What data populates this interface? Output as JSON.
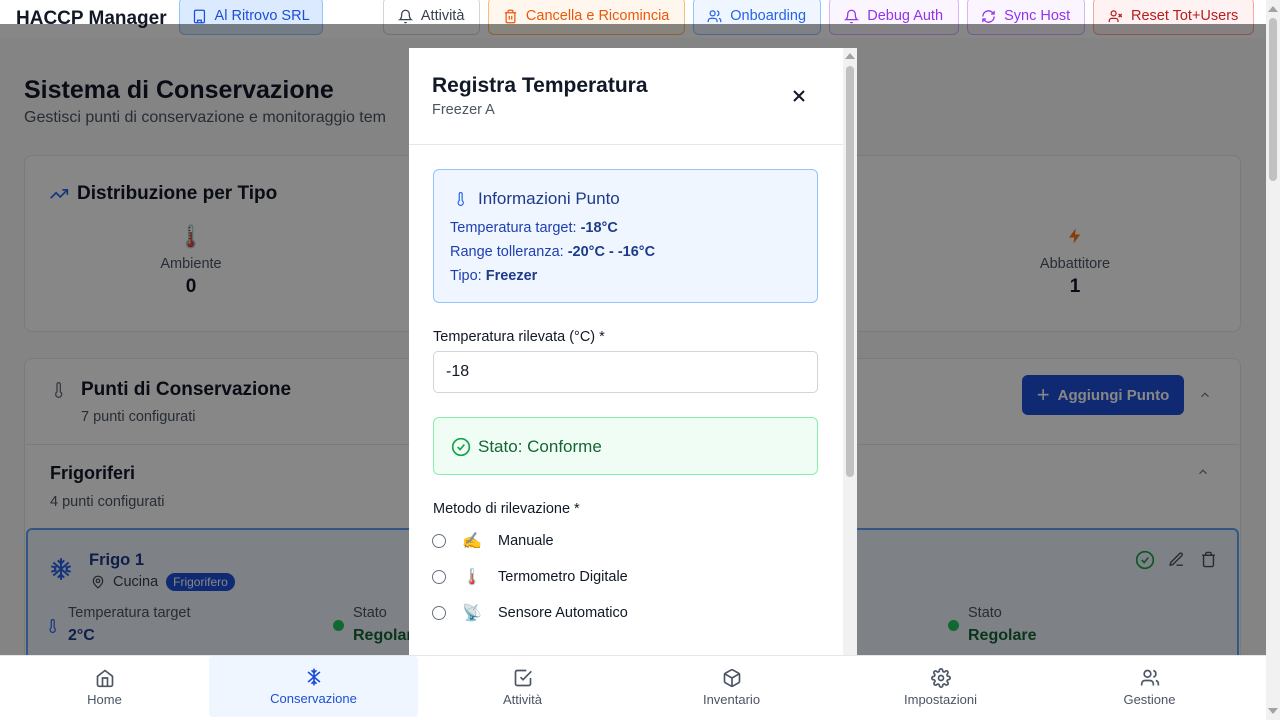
{
  "header": {
    "app_title": "HACCP Manager",
    "company": "Al Ritrovo SRL",
    "buttons": {
      "attivita": "Attività",
      "cancella": "Cancella e Ricomincia",
      "onboarding": "Onboarding",
      "debug": "Debug Auth",
      "sync": "Sync Host",
      "reset": "Reset Tot+Users"
    }
  },
  "page": {
    "title": "Sistema di Conservazione",
    "subtitle": "Gestisci punti di conservazione e monitoraggio tem"
  },
  "distribution": {
    "title": "Distribuzione per Tipo",
    "items": [
      {
        "label": "Ambiente",
        "value": "0",
        "icon": "thermometer-icon"
      },
      {
        "label": "Abbattitore",
        "value": "1",
        "icon": "lightning-icon"
      }
    ]
  },
  "points": {
    "title": "Punti di Conservazione",
    "subtitle": "7 punti configurati",
    "add_button": "Aggiungi Punto"
  },
  "fridges": {
    "title": "Frigoriferi",
    "subtitle": "4 punti configurati",
    "card": {
      "name": "Frigo 1",
      "location": "Cucina",
      "badge": "Frigorifero",
      "temp_label": "Temperatura target",
      "temp_value": "2°C",
      "status_label": "Stato",
      "status_value": "Regolar",
      "status_label_2": "Stato",
      "status_value_2": "Regolare"
    }
  },
  "modal": {
    "title": "Registra Temperatura",
    "subtitle": "Freezer A",
    "info": {
      "title": "Informazioni Punto",
      "target_label": "Temperatura target:",
      "target_value": "-18°C",
      "range_label": "Range tolleranza:",
      "range_value": "-20°C - -16°C",
      "type_label": "Tipo:",
      "type_value": "Freezer"
    },
    "temp_field_label": "Temperatura rilevata (°C) *",
    "temp_value": "-18",
    "status": "Stato: Conforme",
    "method_label": "Metodo di rilevazione *",
    "methods": [
      {
        "emoji": "✍️",
        "label": "Manuale"
      },
      {
        "emoji": "🌡️",
        "label": "Termometro Digitale"
      },
      {
        "emoji": "📡",
        "label": "Sensore Automatico"
      }
    ]
  },
  "bottom_nav": {
    "items": [
      {
        "label": "Home",
        "icon": "home-icon"
      },
      {
        "label": "Conservazione",
        "icon": "snowflake-icon"
      },
      {
        "label": "Attività",
        "icon": "checkbox-icon"
      },
      {
        "label": "Inventario",
        "icon": "package-icon"
      },
      {
        "label": "Impostazioni",
        "icon": "gear-icon"
      },
      {
        "label": "Gestione",
        "icon": "users-icon"
      }
    ]
  },
  "colors": {
    "primary": "#1d4ed8",
    "success": "#166534",
    "overlay": "rgba(0,0,0,0.47)"
  }
}
